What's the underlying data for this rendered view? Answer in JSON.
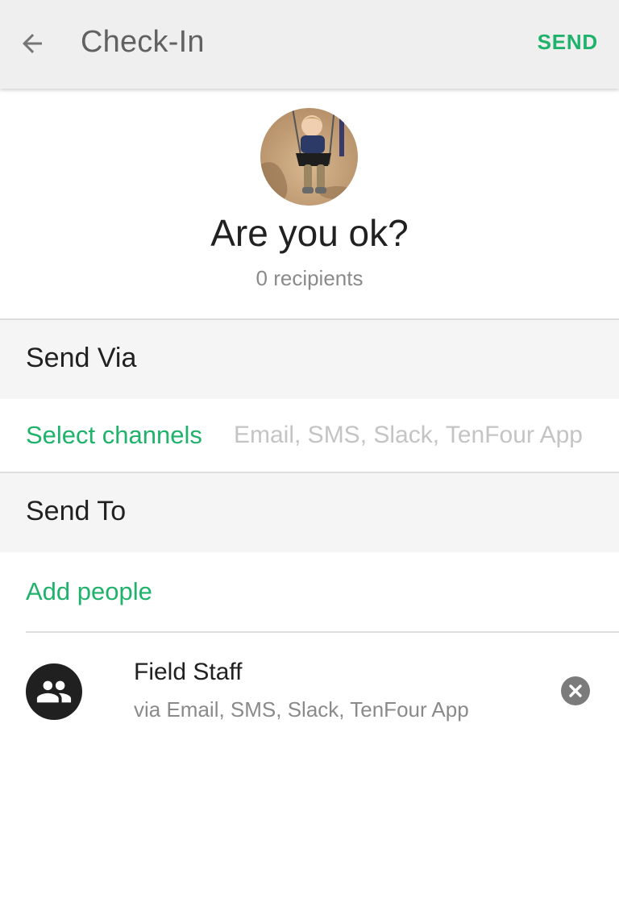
{
  "app_bar": {
    "back_icon": "arrow-left-icon",
    "title": "Check-In",
    "send_label": "SEND",
    "accent_color": "#1fb26b"
  },
  "message": {
    "avatar_alt": "profile photo",
    "title": "Are you ok?",
    "recipients": "0 recipients"
  },
  "send_via": {
    "header": "Send Via",
    "select_label": "Select channels",
    "channels": "Email, SMS, Slack, TenFour App"
  },
  "send_to": {
    "header": "Send To",
    "add_label": "Add people",
    "groups": [
      {
        "icon": "group-icon",
        "name": "Field Staff",
        "via": "via Email, SMS, Slack, TenFour App",
        "remove_icon": "close-circle-icon"
      }
    ]
  }
}
